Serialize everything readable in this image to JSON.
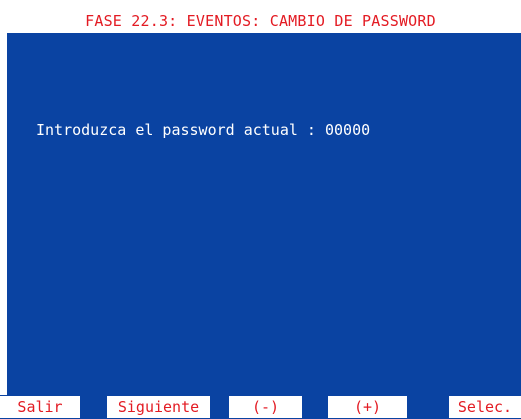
{
  "header": {
    "title": "FASE 22.3: EVENTOS: CAMBIO DE PASSWORD"
  },
  "main": {
    "prompt": "Introduzca el password actual : 00000"
  },
  "function_keys": {
    "salir": "Salir",
    "siguiente": "Siguiente",
    "menos": "(-)",
    "mas": "(+)",
    "selec": "Selec."
  },
  "colors": {
    "background_blue": "#0a43a2",
    "text_red": "#e31b23",
    "text_white": "#ffffff"
  }
}
